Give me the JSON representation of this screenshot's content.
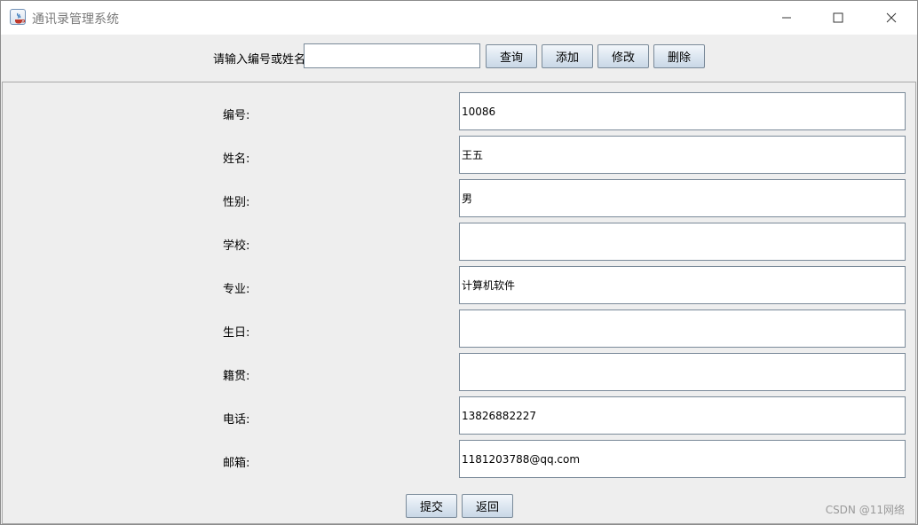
{
  "window": {
    "title": "通讯录管理系统"
  },
  "toolbar": {
    "search_label": "请输入编号或姓名",
    "search_value": "",
    "query_label": "查询",
    "add_label": "添加",
    "edit_label": "修改",
    "delete_label": "删除"
  },
  "form": {
    "fields": [
      {
        "label": "编号:",
        "value": "10086"
      },
      {
        "label": "姓名:",
        "value": "王五"
      },
      {
        "label": "性别:",
        "value": "男"
      },
      {
        "label": "学校:",
        "value": ""
      },
      {
        "label": "专业:",
        "value": "计算机软件"
      },
      {
        "label": "生日:",
        "value": ""
      },
      {
        "label": "籍贯:",
        "value": ""
      },
      {
        "label": "电话:",
        "value": "13826882227"
      },
      {
        "label": "邮箱:",
        "value": "1181203788@qq.com"
      }
    ],
    "submit_label": "提交",
    "back_label": "返回"
  },
  "watermark": "CSDN @11网络"
}
